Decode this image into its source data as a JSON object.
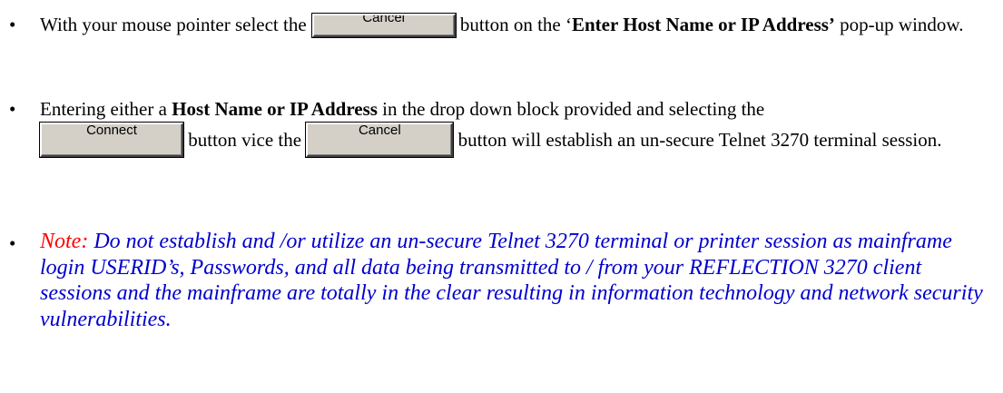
{
  "bullet_glyph": "•",
  "item1": {
    "before": "With your mouse pointer select the",
    "button_label": "Cancel",
    "after": " button on the ‘",
    "bold": "Enter Host Name or IP Address’",
    "end": " pop-up window."
  },
  "item2": {
    "before": "Entering either a ",
    "bold": "Host Name or IP Address",
    "mid": " in the drop down block provided and selecting the",
    "connect_label": "Connect",
    "vice": " button vice the ",
    "cancel_label": "Cancel",
    "end": " button will establish an un-secure Telnet 3270 terminal session."
  },
  "item3": {
    "label": "Note:",
    "text": "  Do not establish and /or utilize an un-secure Telnet 3270 terminal or printer session as mainframe login USERID’s, Passwords, and all data being transmitted to / from your REFLECTION 3270 client sessions and the mainframe are totally in the clear resulting in information technology and network security vulnerabilities."
  },
  "colors": {
    "note_label": "#ff0000",
    "note_text": "#0000cc",
    "button_face": "#d4d0c8"
  }
}
